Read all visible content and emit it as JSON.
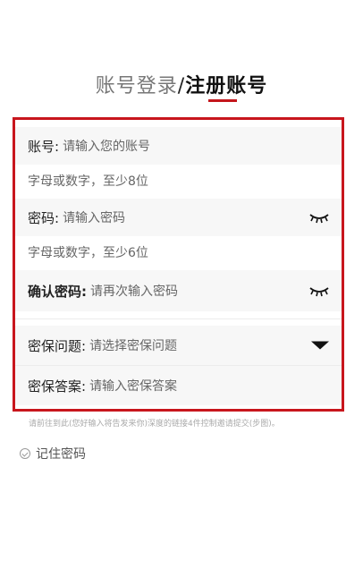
{
  "header": {
    "login_tab": "账号登录",
    "separator": "/",
    "register_tab": "注册账号"
  },
  "form": {
    "account": {
      "label": "账号:",
      "placeholder": "请输入您的账号",
      "hint": "字母或数字，至少8位"
    },
    "password": {
      "label": "密码:",
      "placeholder": "请输入密码",
      "hint": "字母或数字，至少6位",
      "icon": "eye-closed-icon"
    },
    "confirm_password": {
      "label": "确认密码:",
      "placeholder": "请再次输入密码",
      "icon": "eye-closed-icon"
    },
    "security_question": {
      "label": "密保问题:",
      "placeholder": "请选择密保问题",
      "icon": "dropdown-triangle-icon"
    },
    "security_answer": {
      "label": "密保答案:",
      "placeholder": "请输入密保答案"
    }
  },
  "notice": "请前往到此(您好输入将告发来你)深度的链接4件控制邀请提交(步图)。",
  "remember": {
    "label": "记住密码"
  },
  "colors": {
    "accent": "#c8161d"
  }
}
